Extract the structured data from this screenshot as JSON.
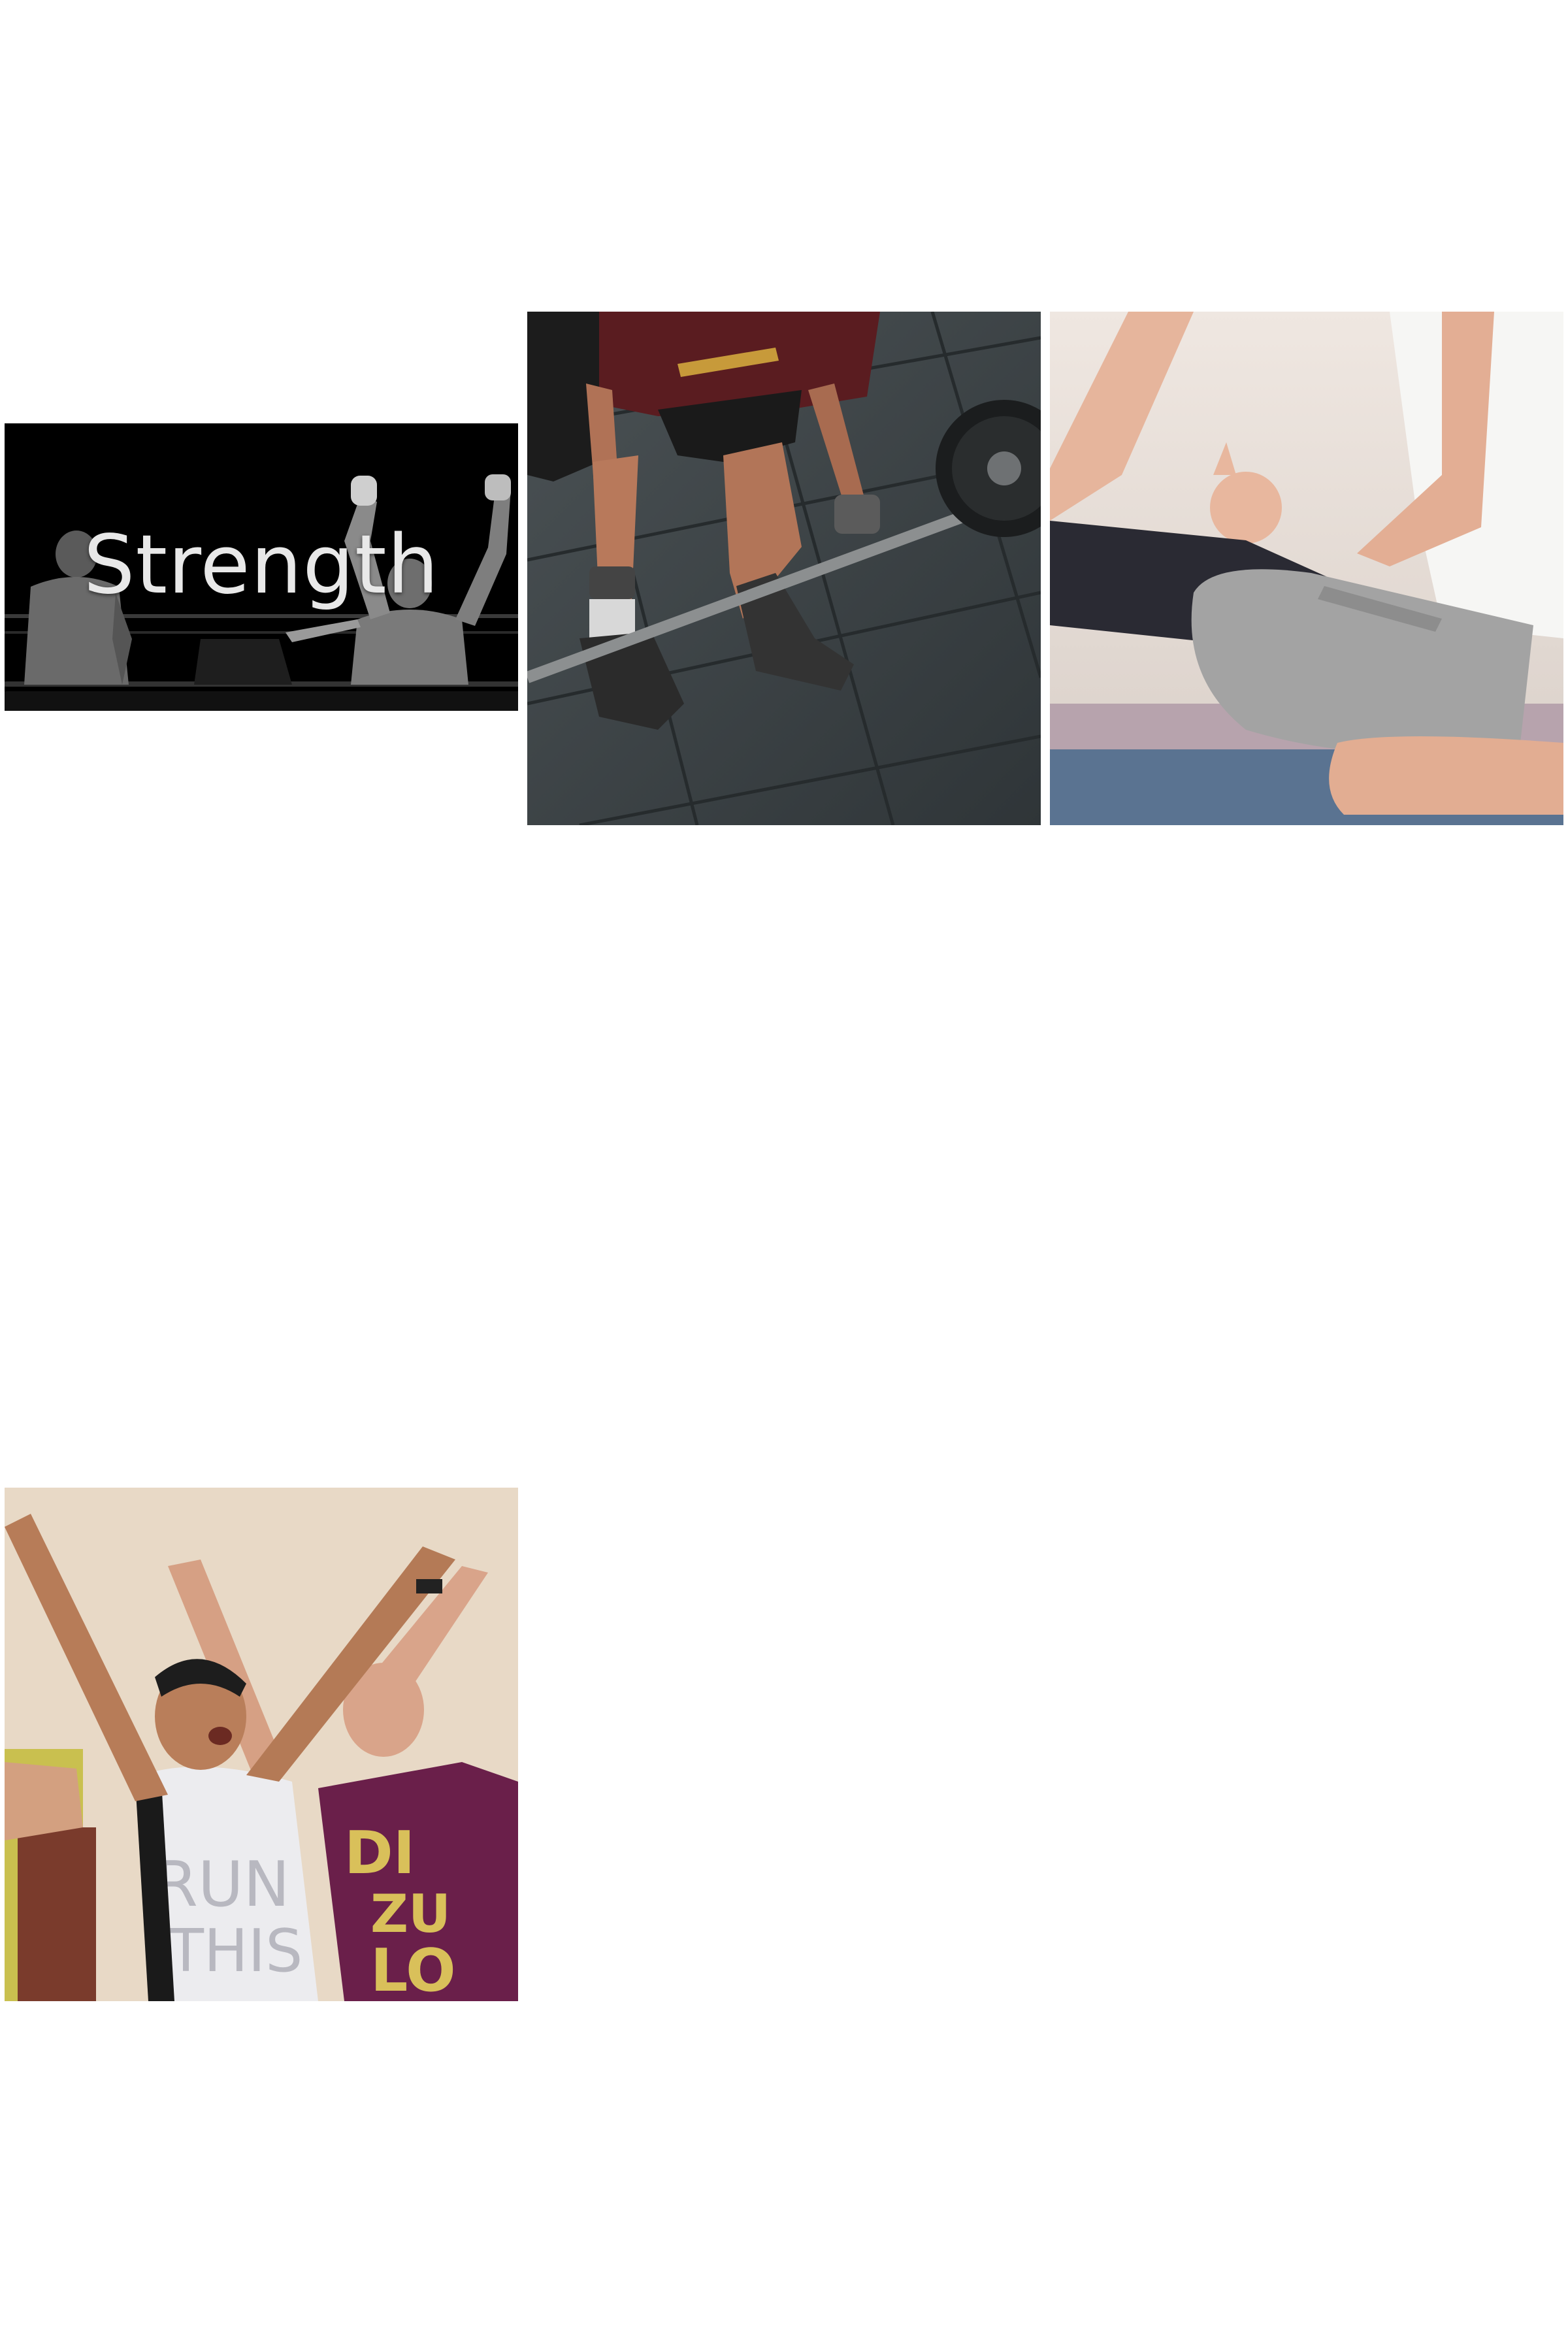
{
  "tiles": [
    {
      "id": "strength",
      "label": "Strength",
      "image": "boxing-ring-photo"
    },
    {
      "id": "deadlift",
      "image": "barbell-deadlift-photo"
    },
    {
      "id": "yoga",
      "image": "yoga-meditation-photo"
    },
    {
      "id": "dance",
      "image": "dance-fitness-class-photo"
    }
  ],
  "colors": {
    "background": "#ffffff",
    "strength_bg": "#000000",
    "strength_text": "#e8e8e8"
  }
}
